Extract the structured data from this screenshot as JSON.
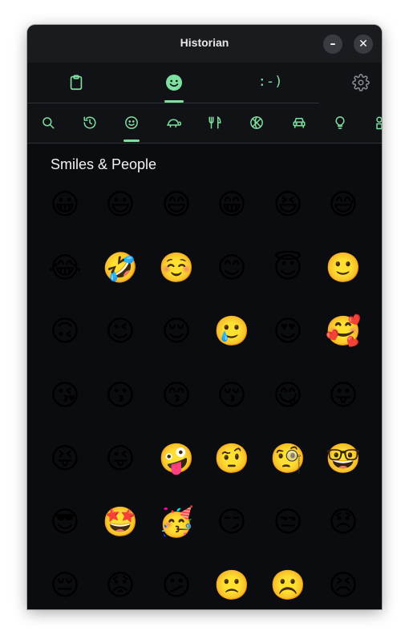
{
  "window": {
    "title": "Historian",
    "minimize_label": "–",
    "close_label": "✕"
  },
  "top_tabs": [
    {
      "name": "clipboard",
      "icon": "clipboard-icon",
      "active": false
    },
    {
      "name": "emoji",
      "icon": "smiley-icon",
      "active": true
    },
    {
      "name": "emoticons",
      "label": ":-)",
      "active": false
    },
    {
      "name": "settings",
      "icon": "gear-icon",
      "active": false
    }
  ],
  "categories": [
    {
      "icon": "search-icon"
    },
    {
      "icon": "history-icon"
    },
    {
      "icon": "smiley-icon",
      "active": true
    },
    {
      "icon": "turtle-icon"
    },
    {
      "icon": "fork-knife-icon"
    },
    {
      "icon": "basketball-icon"
    },
    {
      "icon": "car-icon"
    },
    {
      "icon": "lightbulb-icon"
    },
    {
      "icon": "symbols-icon"
    }
  ],
  "section": {
    "title": "Smiles & People"
  },
  "emojis": [
    "😀",
    "😃",
    "😄",
    "😁",
    "😆",
    "😅",
    "😂",
    "🤣",
    "☺️",
    "😊",
    "😇",
    "🙂",
    "🙃",
    "😉",
    "😌",
    "🥲",
    "😍",
    "🥰",
    "😘",
    "😗",
    "😙",
    "😚",
    "😋",
    "😛",
    "😝",
    "😜",
    "🤪",
    "🤨",
    "🧐",
    "🤓",
    "😎",
    "🤩",
    "🥳",
    "😏",
    "😒",
    "😞",
    "😔",
    "😟",
    "😕",
    "🙁",
    "☹️",
    "😣"
  ],
  "colors": {
    "accent": "#7ee0a0",
    "background": "#0b0c10",
    "titlebar": "#1a1b1f"
  }
}
